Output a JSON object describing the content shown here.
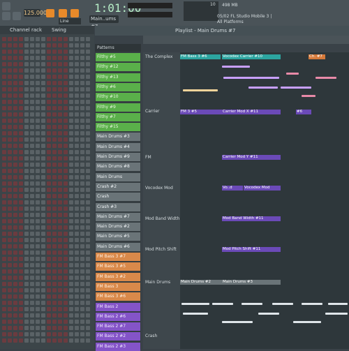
{
  "toolbar": {
    "time": "1:01:00",
    "tempo": "125.000",
    "pattern": "Main..ums #7",
    "snap": "Line",
    "ram": "498 MB",
    "cpu": "10",
    "news_line1": "05/02 FL Studio Mobile 3 |",
    "news_line2": "All Platforms"
  },
  "channel_rack": {
    "title": "Channel rack",
    "swing": "Swing"
  },
  "playlist": {
    "title": "Playlist - Main Drums #7"
  },
  "patterns": {
    "header": "Patterns",
    "items": [
      {
        "label": "Filthy #5",
        "color": "green"
      },
      {
        "label": "Filthy #12",
        "color": "green"
      },
      {
        "label": "Filthy #13",
        "color": "green"
      },
      {
        "label": "Filthy #6",
        "color": "green"
      },
      {
        "label": "Filthy #10",
        "color": "green"
      },
      {
        "label": "Filthy #9",
        "color": "green"
      },
      {
        "label": "Filthy #7",
        "color": "green"
      },
      {
        "label": "Filthy #15",
        "color": "green"
      },
      {
        "label": "Main Drums #3",
        "color": "gray"
      },
      {
        "label": "Main Drums #4",
        "color": "gray"
      },
      {
        "label": "Main Drums #9",
        "color": "gray"
      },
      {
        "label": "Main Drums #8",
        "color": "gray"
      },
      {
        "label": "Main Drums",
        "color": "gray"
      },
      {
        "label": "Crash #2",
        "color": "gray"
      },
      {
        "label": "Crash",
        "color": "gray"
      },
      {
        "label": "Crash #3",
        "color": "gray"
      },
      {
        "label": "Main Drums #7",
        "color": "gray"
      },
      {
        "label": "Main Drums #2",
        "color": "gray"
      },
      {
        "label": "Main Drums #5",
        "color": "gray"
      },
      {
        "label": "Main Drums #6",
        "color": "gray"
      },
      {
        "label": "FM Bass 3 #7",
        "color": "orange"
      },
      {
        "label": "FM Bass 3 #5",
        "color": "orange"
      },
      {
        "label": "FM Bass 3 #2",
        "color": "orange"
      },
      {
        "label": "FM Bass 3",
        "color": "orange"
      },
      {
        "label": "FM Bass 3 #6",
        "color": "orange"
      },
      {
        "label": "FM Bass 2",
        "color": "purple"
      },
      {
        "label": "FM Bass 2 #6",
        "color": "purple"
      },
      {
        "label": "FM Bass 2 #7",
        "color": "purple"
      },
      {
        "label": "FM Bass 2 #2",
        "color": "purple"
      },
      {
        "label": "FM Bass 2 #3",
        "color": "purple"
      }
    ]
  },
  "tracks": [
    {
      "name": "The Complex"
    },
    {
      "name": "Carrier"
    },
    {
      "name": "FM"
    },
    {
      "name": "Vocodex Mod"
    },
    {
      "name": "Mod Band Width"
    },
    {
      "name": "Mod Pitch Shift"
    },
    {
      "name": "Main Drums"
    },
    {
      "name": "Crash"
    }
  ],
  "clips": [
    {
      "label": "FM Bass 3 #6",
      "color": "teal"
    },
    {
      "label": "Vocodex Carrier #10",
      "color": "teal"
    },
    {
      "label": "Ch. #7",
      "color": "orange"
    },
    {
      "label": "FM 3 #5",
      "color": "purple"
    },
    {
      "label": "Carrier Mod X #11",
      "color": "purple"
    },
    {
      "label": "#6",
      "color": "purple"
    },
    {
      "label": "Carrier Mod Y #11",
      "color": "purple"
    },
    {
      "label": "Vo..d",
      "color": "purple"
    },
    {
      "label": "Vocodex Mod",
      "color": "purple"
    },
    {
      "label": "Mod Band Width #11",
      "color": "purple"
    },
    {
      "label": "Mod Pitch Shift #11",
      "color": "purple"
    },
    {
      "label": "Main Drums #2",
      "color": "gray"
    },
    {
      "label": "Main Drums #3",
      "color": "gray"
    }
  ]
}
